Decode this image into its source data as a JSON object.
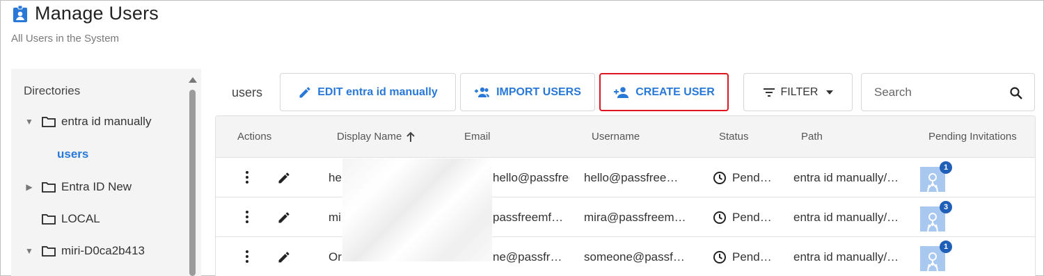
{
  "header": {
    "title": "Manage Users",
    "subtitle": "All Users in the System"
  },
  "sidebar": {
    "heading": "Directories",
    "items": [
      {
        "label": "entra id manually",
        "expanded": true
      },
      {
        "label": "users",
        "active": true
      },
      {
        "label": "Entra ID New",
        "expanded": false
      },
      {
        "label": "LOCAL"
      },
      {
        "label": "miri-D0ca2b413",
        "expanded": true
      }
    ]
  },
  "toolbar": {
    "context_label": "users",
    "edit_label": "EDIT entra id manually",
    "import_label": "IMPORT USERS",
    "create_label": "CREATE USER",
    "filter_label": "FILTER",
    "search_placeholder": "Search"
  },
  "table": {
    "columns": [
      "Actions",
      "Display Name",
      "Email",
      "Username",
      "Status",
      "Path",
      "Pending Invitations"
    ],
    "sort": {
      "column": "Display Name",
      "direction": "asc"
    },
    "rows": [
      {
        "display_name": "hell",
        "email": "hello@passfreem…",
        "username": "hello@passfree…",
        "status": "Pend…",
        "path": "entra id manually/…",
        "pending": "1"
      },
      {
        "display_name": "mi",
        "email": "passfreemf…",
        "username": "mira@passfreem…",
        "status": "Pend…",
        "path": "entra id manually/…",
        "pending": "3"
      },
      {
        "display_name": "Or",
        "email": "ne@passfr…",
        "username": "someone@passf…",
        "status": "Pend…",
        "path": "entra id manually/…",
        "pending": "1"
      }
    ]
  },
  "colors": {
    "accent": "#2878d8",
    "highlight_border": "#e0141e",
    "badge": "#1f5fb8",
    "avatar_bg": "#a9c8ef"
  }
}
